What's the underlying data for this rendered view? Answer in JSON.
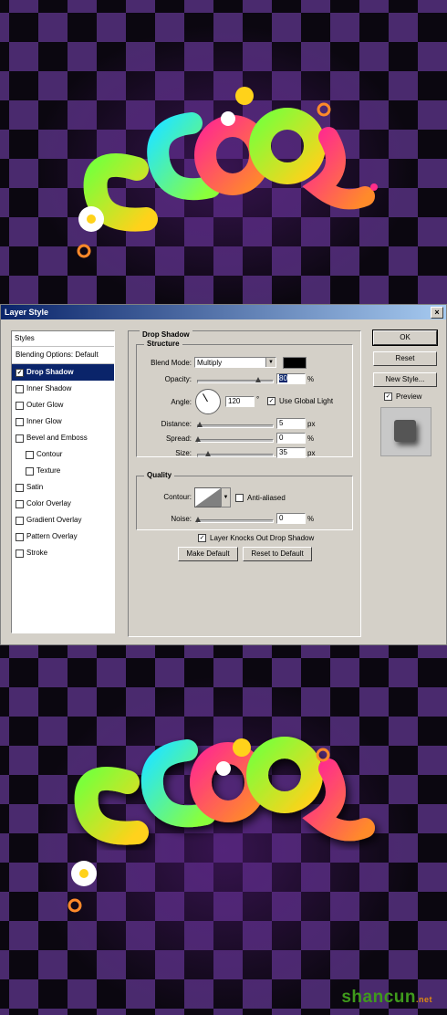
{
  "dialog": {
    "title": "Layer Style",
    "close_glyph": "×",
    "styles_header": "Styles",
    "style_items": [
      {
        "label": "Blending Options: Default",
        "checkbox": false,
        "checked": false,
        "selected": false,
        "indent": false
      },
      {
        "label": "Drop Shadow",
        "checkbox": true,
        "checked": true,
        "selected": true,
        "indent": false
      },
      {
        "label": "Inner Shadow",
        "checkbox": true,
        "checked": false,
        "selected": false,
        "indent": false
      },
      {
        "label": "Outer Glow",
        "checkbox": true,
        "checked": false,
        "selected": false,
        "indent": false
      },
      {
        "label": "Inner Glow",
        "checkbox": true,
        "checked": false,
        "selected": false,
        "indent": false
      },
      {
        "label": "Bevel and Emboss",
        "checkbox": true,
        "checked": false,
        "selected": false,
        "indent": false
      },
      {
        "label": "Contour",
        "checkbox": true,
        "checked": false,
        "selected": false,
        "indent": true
      },
      {
        "label": "Texture",
        "checkbox": true,
        "checked": false,
        "selected": false,
        "indent": true
      },
      {
        "label": "Satin",
        "checkbox": true,
        "checked": false,
        "selected": false,
        "indent": false
      },
      {
        "label": "Color Overlay",
        "checkbox": true,
        "checked": false,
        "selected": false,
        "indent": false
      },
      {
        "label": "Gradient Overlay",
        "checkbox": true,
        "checked": false,
        "selected": false,
        "indent": false
      },
      {
        "label": "Pattern Overlay",
        "checkbox": true,
        "checked": false,
        "selected": false,
        "indent": false
      },
      {
        "label": "Stroke",
        "checkbox": true,
        "checked": false,
        "selected": false,
        "indent": false
      }
    ],
    "panel_title": "Drop Shadow",
    "structure": {
      "title": "Structure",
      "blend_mode_label": "Blend Mode:",
      "blend_mode_value": "Multiply",
      "shadow_color": "#000000",
      "opacity_label": "Opacity:",
      "opacity_value": "80",
      "opacity_unit": "%",
      "opacity_level": 0.8,
      "angle_label": "Angle:",
      "angle_value": "120",
      "angle_unit": "°",
      "global_light_label": "Use Global Light",
      "global_light_checked": true,
      "distance_label": "Distance:",
      "distance_value": "5",
      "distance_unit": "px",
      "distance_level": 0.02,
      "spread_label": "Spread:",
      "spread_value": "0",
      "spread_unit": "%",
      "spread_level": 0.0,
      "size_label": "Size:",
      "size_value": "35",
      "size_unit": "px",
      "size_level": 0.14
    },
    "quality": {
      "title": "Quality",
      "contour_label": "Contour:",
      "antialiased_label": "Anti-aliased",
      "noise_label": "Noise:",
      "noise_value": "0",
      "noise_unit": "%",
      "noise_level": 0.0
    },
    "knockout_label": "Layer Knocks Out Drop Shadow",
    "knockout_checked": true,
    "make_default_label": "Make Default",
    "reset_default_label": "Reset to Default",
    "ok_label": "OK",
    "reset_label": "Reset",
    "new_style_label": "New Style...",
    "preview_label": "Preview",
    "preview_checked": true
  },
  "watermark": {
    "text": "shancun",
    "suffix": ".net"
  }
}
